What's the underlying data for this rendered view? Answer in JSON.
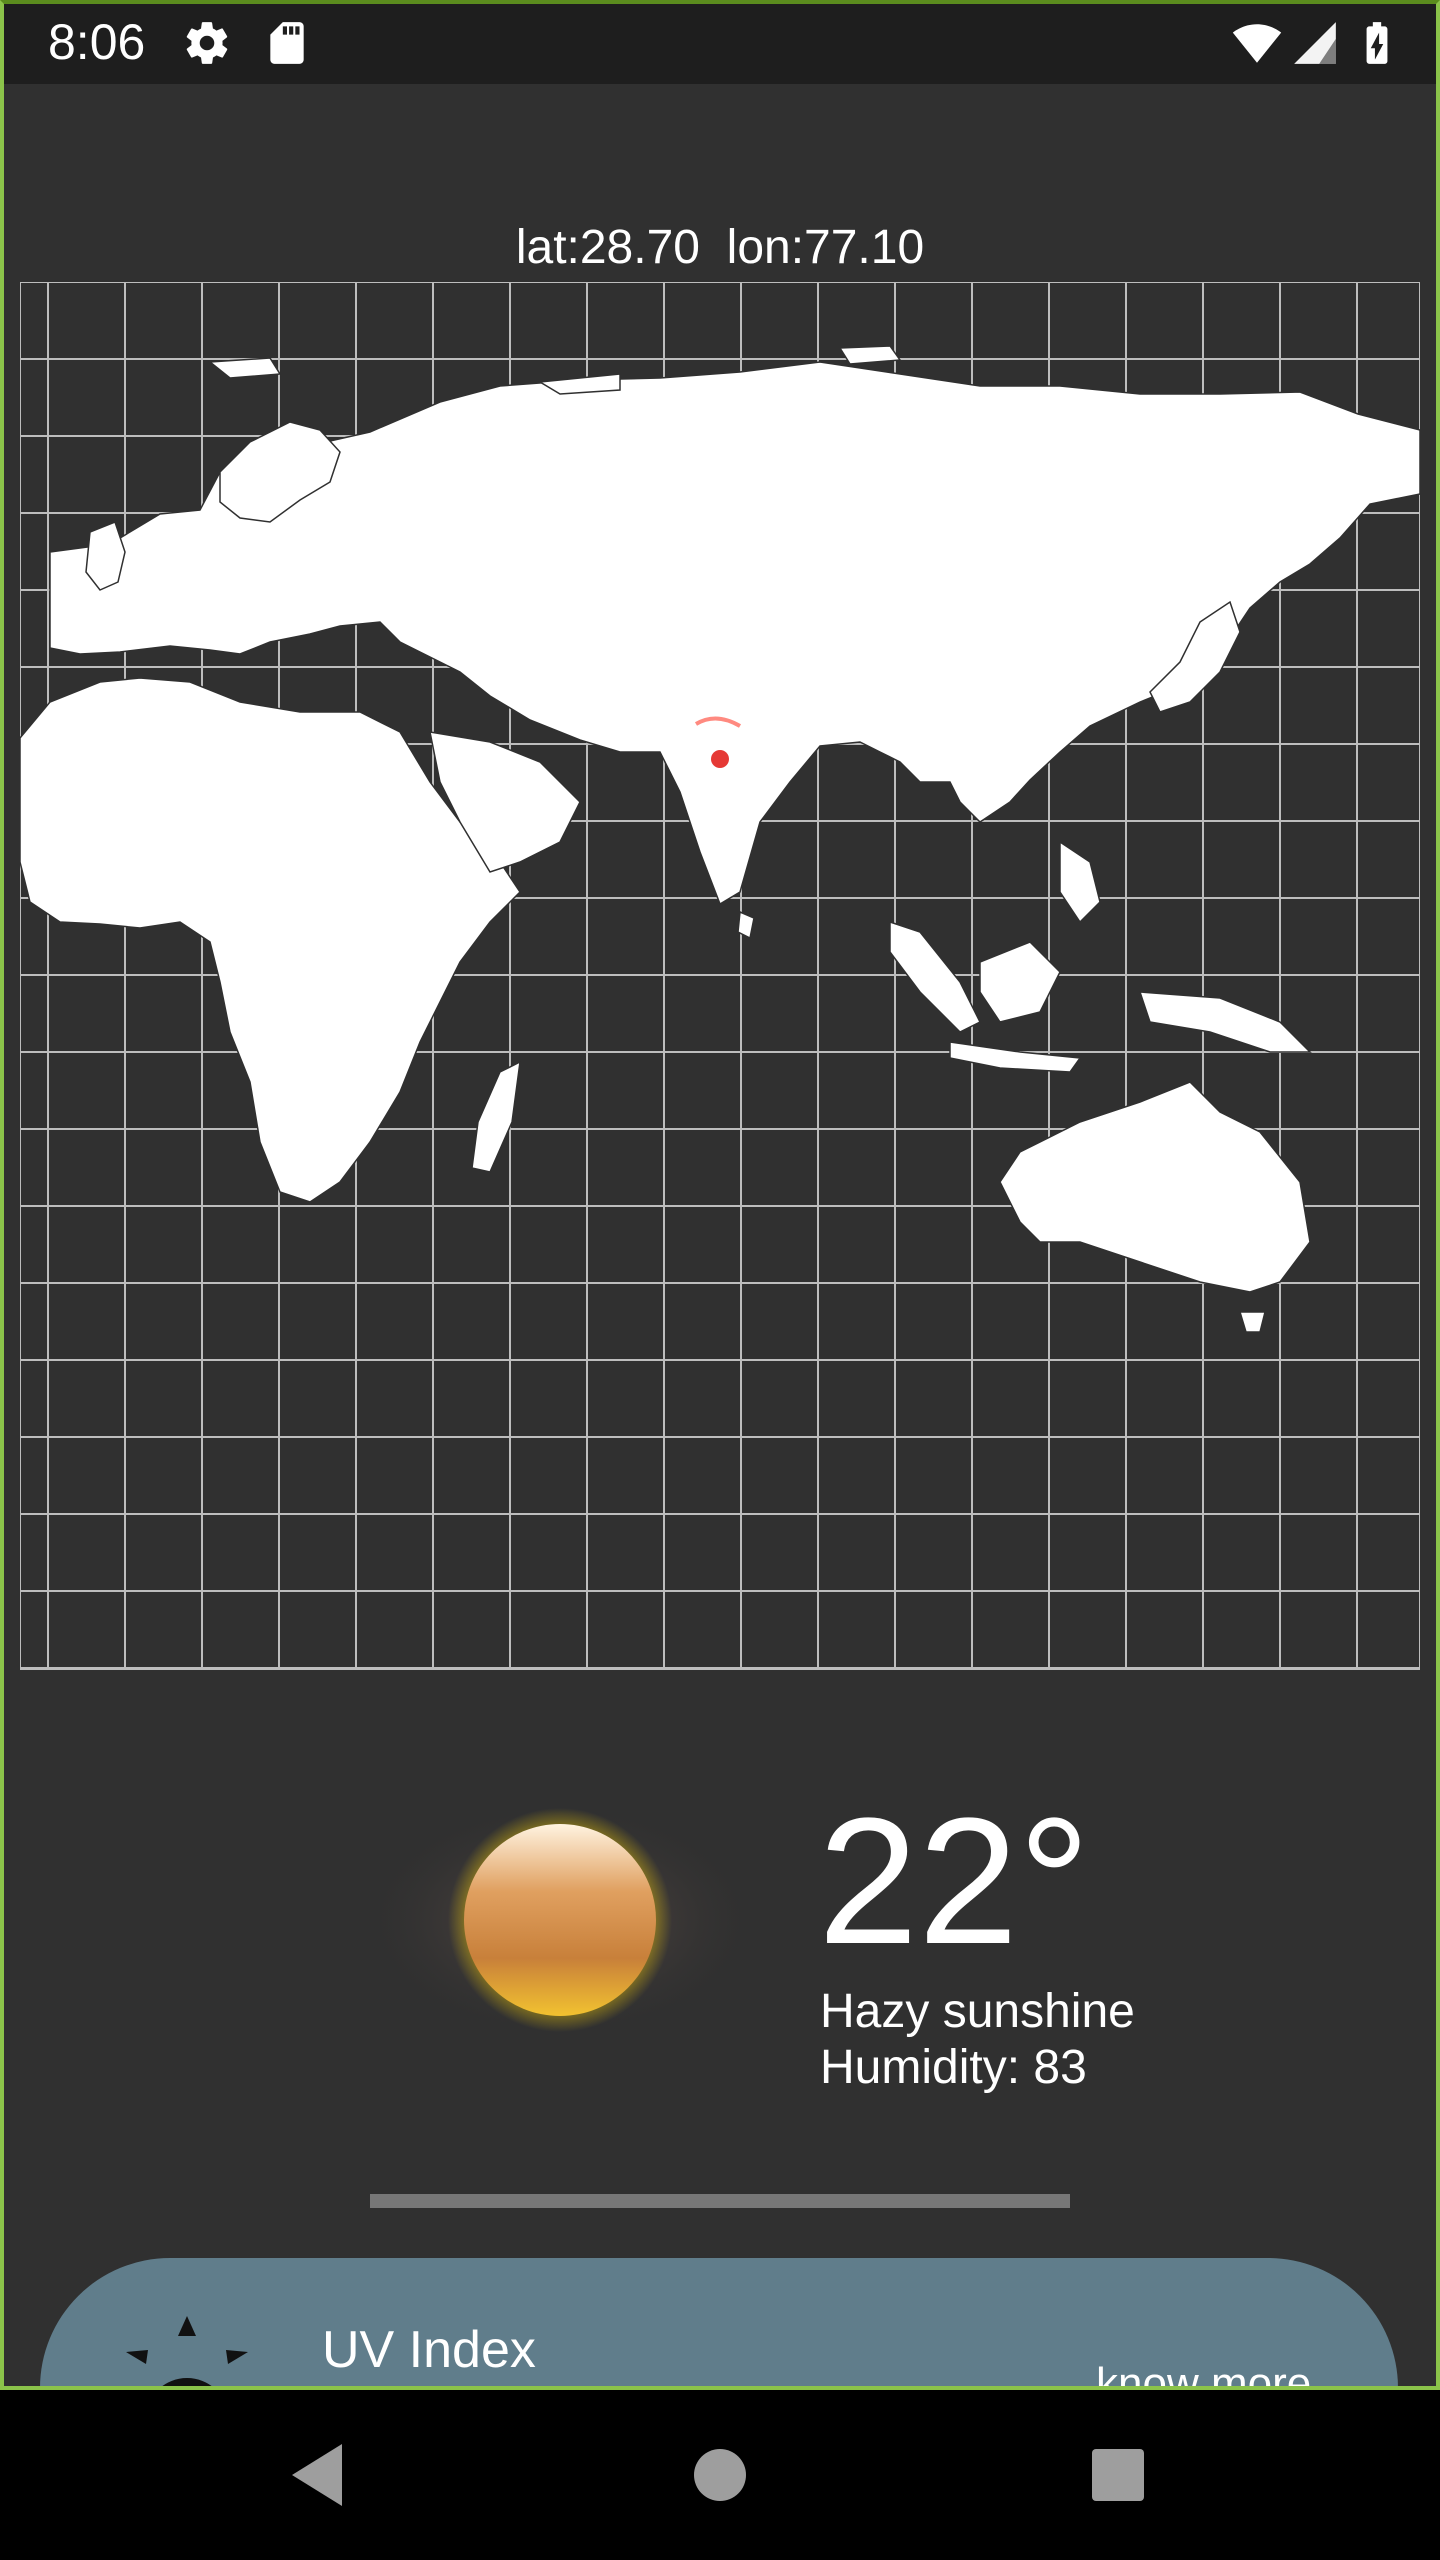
{
  "status_bar": {
    "time": "8:06",
    "icons": [
      "gear-icon",
      "sd-card-icon",
      "wifi-icon",
      "cell-signal-icon",
      "battery-charging-icon"
    ]
  },
  "location": {
    "coords_text": "lat:28.70  lon:77.10"
  },
  "map": {
    "marker_color": "#e53935"
  },
  "weather": {
    "temperature": "22°",
    "condition": "Hazy sunshine",
    "humidity": "Humidity: 83",
    "icon": "hazy-sun-icon"
  },
  "uv_card": {
    "title": "UV Index",
    "link": "know more",
    "icon": "uv-sun-icon",
    "color": "#607d8b"
  },
  "nav_bar": {
    "buttons": [
      "back-icon",
      "home-icon",
      "recents-icon"
    ]
  },
  "colors": {
    "background": "#303030",
    "frame": "#8bc34a"
  }
}
